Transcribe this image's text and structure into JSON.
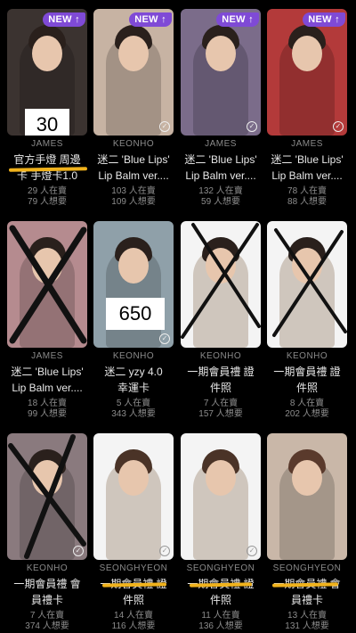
{
  "cards": [
    {
      "badge": "NEW ↑",
      "artist": "JAMES",
      "title1": "官方手燈 周邊",
      "title2": "卡 手燈卡1.0",
      "sell": "29 人在賣",
      "want": "79 人想要",
      "overlay": "30",
      "bg": "#3b3330"
    },
    {
      "badge": "NEW ↑",
      "artist": "KEONHO",
      "title1": "迷二 'Blue Lips'",
      "title2": "Lip Balm ver....",
      "sell": "103 人在賣",
      "want": "109 人想要",
      "bg": "#c7b3a3"
    },
    {
      "badge": "NEW ↑",
      "artist": "JAMES",
      "title1": "迷二 'Blue Lips'",
      "title2": "Lip Balm ver....",
      "sell": "132 人在賣",
      "want": "59 人想要",
      "bg": "#7b6c8a"
    },
    {
      "badge": "NEW ↑",
      "artist": "JAMES",
      "title1": "迷二 'Blue Lips'",
      "title2": "Lip Balm ver....",
      "sell": "78 人在賣",
      "want": "88 人想要",
      "bg": "#b33a3a"
    },
    {
      "badge": "",
      "artist": "JAMES",
      "title1": "迷二 'Blue Lips'",
      "title2": "Lip Balm ver....",
      "sell": "18 人在賣",
      "want": "99 人想要",
      "bg": "#b58b8f"
    },
    {
      "badge": "",
      "artist": "KEONHO",
      "title1": "迷二 yzy 4.0",
      "title2": "幸運卡",
      "sell": "5 人在賣",
      "want": "343 人想要",
      "overlay": "650",
      "bg": "#8fa0a9"
    },
    {
      "badge": "",
      "artist": "KEONHO",
      "title1": "一期會員禮 證",
      "title2": "件照",
      "sell": "7 人在賣",
      "want": "157 人想要",
      "bg": "white"
    },
    {
      "badge": "",
      "artist": "KEONHO",
      "title1": "一期會員禮 證",
      "title2": "件照",
      "sell": "8 人在賣",
      "want": "202 人想要",
      "bg": "white"
    },
    {
      "badge": "",
      "artist": "KEONHO",
      "title1": "一期會員禮 會",
      "title2": "員禮卡",
      "sell": "7 人在賣",
      "want": "374 人想要",
      "bg": "#8a7a7e"
    },
    {
      "badge": "",
      "artist": "SEONGHYEON",
      "title1": "一期會員禮 證",
      "title2": "件照",
      "sell": "14 人在賣",
      "want": "116 人想要",
      "bg": "white"
    },
    {
      "badge": "",
      "artist": "SEONGHYEON",
      "title1": "一期會員禮 證",
      "title2": "件照",
      "sell": "11 人在賣",
      "want": "136 人想要",
      "bg": "white"
    },
    {
      "badge": "",
      "artist": "SEONGHYEON",
      "title1": "一期會員禮 會",
      "title2": "員禮卡",
      "sell": "13 人在賣",
      "want": "131 人想要",
      "bg": "#c9b7a8"
    }
  ]
}
